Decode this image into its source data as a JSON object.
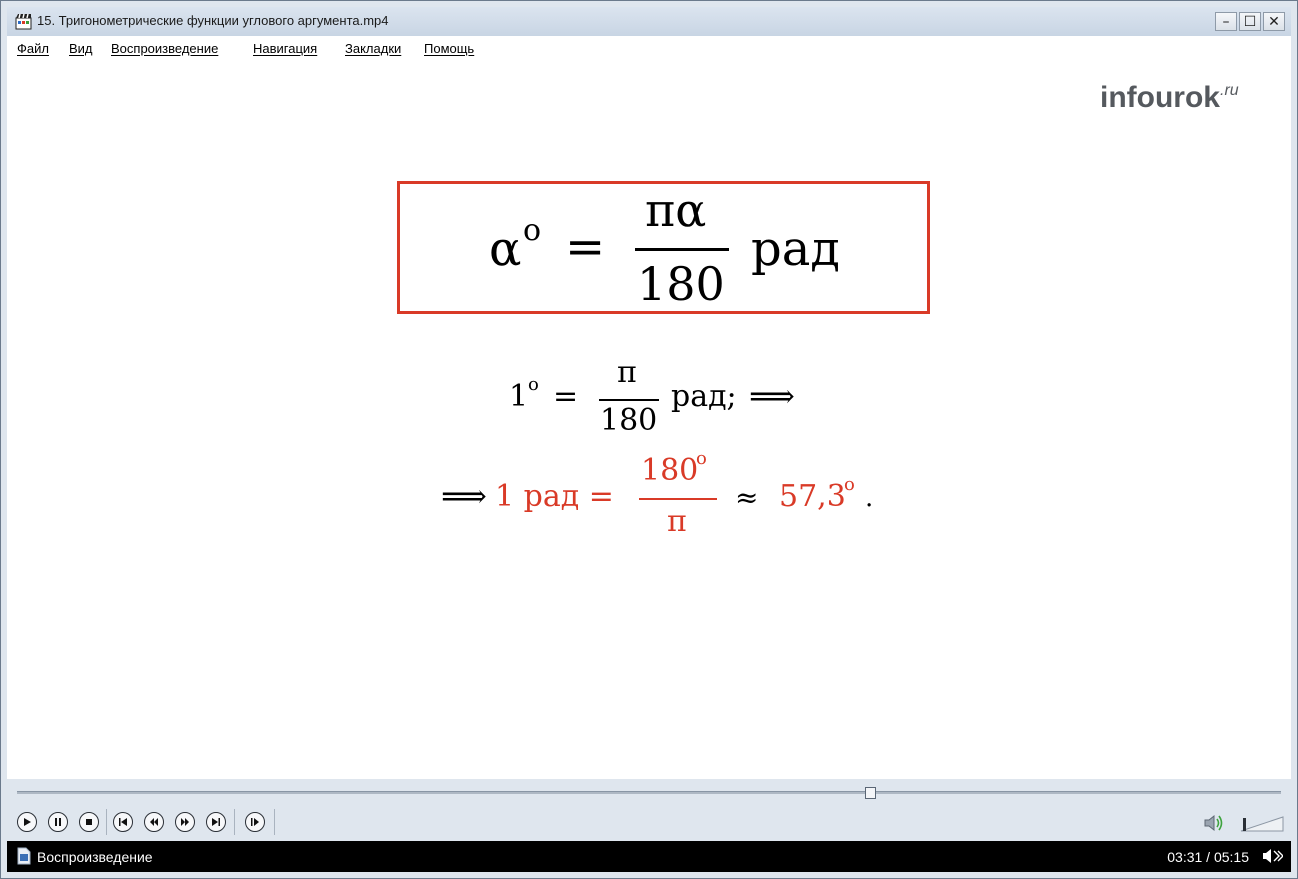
{
  "window": {
    "title": "15. Тригонометрические функции углового аргумента.mp4",
    "minimize_glyph": "–",
    "maximize_glyph": "☐",
    "close_glyph": "✕"
  },
  "menu": {
    "items": [
      "Файл",
      "Вид",
      "Воспроизведение",
      "Навигация",
      "Закладки",
      "Помощь"
    ]
  },
  "slide": {
    "logo_main": "infourok",
    "logo_suffix": ".ru",
    "formula1": {
      "lhs": "α",
      "lhs_sup": "o",
      "eq": "=",
      "num": "πα",
      "den": "180",
      "unit": "рад"
    },
    "formula2": {
      "lhs": "1",
      "lhs_sup": "o",
      "eq": "=",
      "num": "π",
      "den": "180",
      "unit": "рад;",
      "arrow": "⟹"
    },
    "formula3": {
      "arrow": "⟹",
      "lhs": "1 рад =",
      "num": "180",
      "num_sup": "o",
      "den": "π",
      "approx": "≈",
      "value": "57,3",
      "value_sup": "o",
      "end": "."
    }
  },
  "player": {
    "seek_fraction": 0.675,
    "buttons": [
      "play-icon",
      "pause-icon",
      "stop-icon",
      "previous-icon",
      "rewind-icon",
      "fast-forward-icon",
      "next-icon",
      "frame-step-icon"
    ],
    "status_text": "Воспроизведение",
    "time": "03:31 / 05:15"
  },
  "colors": {
    "accent_red": "#d93a27",
    "status_bg": "#000000"
  }
}
